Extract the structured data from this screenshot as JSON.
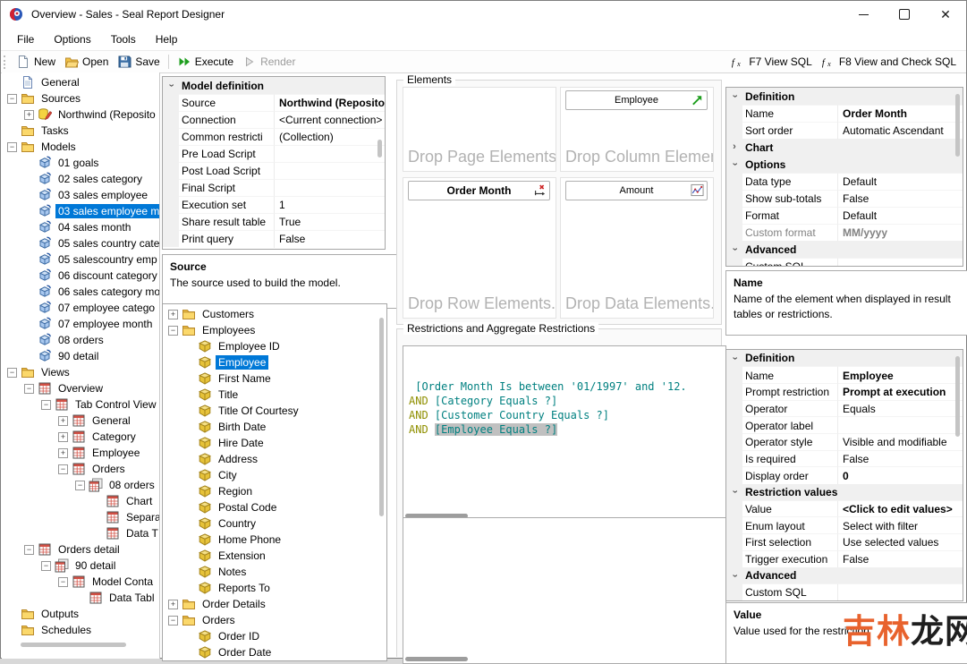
{
  "window": {
    "title": "Overview - Sales - Seal Report Designer"
  },
  "menu": {
    "items": [
      "File",
      "Options",
      "Tools",
      "Help"
    ]
  },
  "toolbar": {
    "buttons": [
      {
        "label": "New",
        "icon": "new-document-icon"
      },
      {
        "label": "Open",
        "icon": "open-folder-icon"
      },
      {
        "label": "Save",
        "icon": "save-icon"
      }
    ],
    "execute": {
      "label": "Execute",
      "icon": "execute-icon"
    },
    "render": {
      "label": "Render",
      "icon": "render-icon"
    },
    "right_buttons": [
      {
        "label": "F7 View SQL",
        "icon": "function-icon"
      },
      {
        "label": "F8 View and Check SQL",
        "icon": "function-icon"
      }
    ]
  },
  "left_tree": {
    "items": [
      {
        "level": 0,
        "exp": "",
        "icon": "document-icon",
        "label": "General"
      },
      {
        "level": 0,
        "exp": "-",
        "icon": "folder-icon",
        "label": "Sources"
      },
      {
        "level": 1,
        "exp": "+",
        "icon": "database-edit-icon",
        "label": "Northwind (Reposito"
      },
      {
        "level": 0,
        "exp": "",
        "icon": "folder-icon",
        "label": "Tasks"
      },
      {
        "level": 0,
        "exp": "-",
        "icon": "folder-icon",
        "label": "Models"
      },
      {
        "level": 1,
        "exp": "",
        "icon": "model-icon",
        "label": "01 goals"
      },
      {
        "level": 1,
        "exp": "",
        "icon": "model-icon",
        "label": "02 sales category"
      },
      {
        "level": 1,
        "exp": "",
        "icon": "model-icon",
        "label": "03 sales employee"
      },
      {
        "level": 1,
        "exp": "",
        "icon": "model-icon",
        "label": "03 sales employee m",
        "selected": true
      },
      {
        "level": 1,
        "exp": "",
        "icon": "model-icon",
        "label": "04 sales month"
      },
      {
        "level": 1,
        "exp": "",
        "icon": "model-icon",
        "label": "05 sales country cate"
      },
      {
        "level": 1,
        "exp": "",
        "icon": "model-icon",
        "label": "05 salescountry emp"
      },
      {
        "level": 1,
        "exp": "",
        "icon": "model-icon",
        "label": "06 discount category"
      },
      {
        "level": 1,
        "exp": "",
        "icon": "model-icon",
        "label": "06 sales category mo"
      },
      {
        "level": 1,
        "exp": "",
        "icon": "model-icon",
        "label": "07 employee catego"
      },
      {
        "level": 1,
        "exp": "",
        "icon": "model-icon",
        "label": "07 employee month"
      },
      {
        "level": 1,
        "exp": "",
        "icon": "model-icon",
        "label": "08 orders"
      },
      {
        "level": 1,
        "exp": "",
        "icon": "model-icon",
        "label": "90 detail"
      },
      {
        "level": 0,
        "exp": "-",
        "icon": "folder-icon",
        "label": "Views"
      },
      {
        "level": 1,
        "exp": "-",
        "icon": "view-icon",
        "label": "Overview"
      },
      {
        "level": 2,
        "exp": "-",
        "icon": "view-icon",
        "label": "Tab Control View"
      },
      {
        "level": 3,
        "exp": "+",
        "icon": "view-icon",
        "label": "General"
      },
      {
        "level": 3,
        "exp": "+",
        "icon": "view-icon",
        "label": "Category"
      },
      {
        "level": 3,
        "exp": "+",
        "icon": "view-icon",
        "label": "Employee"
      },
      {
        "level": 3,
        "exp": "-",
        "icon": "view-icon",
        "label": "Orders"
      },
      {
        "level": 4,
        "exp": "-",
        "icon": "views-stack-icon",
        "label": "08 orders"
      },
      {
        "level": 5,
        "exp": "",
        "icon": "view-icon",
        "label": "Chart"
      },
      {
        "level": 5,
        "exp": "",
        "icon": "view-icon",
        "label": "Separa"
      },
      {
        "level": 5,
        "exp": "",
        "icon": "view-icon",
        "label": "Data T"
      },
      {
        "level": 1,
        "exp": "-",
        "icon": "view-icon",
        "label": "Orders detail"
      },
      {
        "level": 2,
        "exp": "-",
        "icon": "views-stack-icon",
        "label": "90 detail"
      },
      {
        "level": 3,
        "exp": "-",
        "icon": "view-icon",
        "label": "Model Conta"
      },
      {
        "level": 4,
        "exp": "",
        "icon": "view-icon",
        "label": "Data Tabl"
      },
      {
        "level": 0,
        "exp": "",
        "icon": "folder-icon",
        "label": "Outputs"
      },
      {
        "level": 0,
        "exp": "",
        "icon": "folder-icon",
        "label": "Schedules"
      }
    ]
  },
  "model_grid": {
    "rows": [
      {
        "h": "Model definition",
        "chev": "down"
      },
      {
        "l": "Source",
        "v": "Northwind (Reposito",
        "vb": true
      },
      {
        "l": "Connection",
        "v": "<Current connection>"
      },
      {
        "l": "Common restricti",
        "v": "(Collection)"
      },
      {
        "l": "Pre Load Script",
        "v": ""
      },
      {
        "l": "Post Load Script",
        "v": ""
      },
      {
        "l": "Final Script",
        "v": ""
      },
      {
        "l": "Execution set",
        "v": "1"
      },
      {
        "l": "Share result table",
        "v": "True"
      },
      {
        "l": "Print query",
        "v": "False"
      }
    ]
  },
  "source_desc": {
    "title": "Source",
    "text": "The source used to build the model."
  },
  "fields_tree": {
    "items": [
      {
        "level": 0,
        "exp": "+",
        "icon": "folder-icon",
        "label": "Customers"
      },
      {
        "level": 0,
        "exp": "-",
        "icon": "folder-icon",
        "label": "Employees"
      },
      {
        "level": 1,
        "exp": "",
        "icon": "cube-icon",
        "label": "Employee ID"
      },
      {
        "level": 1,
        "exp": "",
        "icon": "cube-icon",
        "label": "Employee",
        "selected": true
      },
      {
        "level": 1,
        "exp": "",
        "icon": "cube-icon",
        "label": "First Name"
      },
      {
        "level": 1,
        "exp": "",
        "icon": "cube-icon",
        "label": "Title"
      },
      {
        "level": 1,
        "exp": "",
        "icon": "cube-icon",
        "label": "Title Of Courtesy"
      },
      {
        "level": 1,
        "exp": "",
        "icon": "cube-icon",
        "label": "Birth Date"
      },
      {
        "level": 1,
        "exp": "",
        "icon": "cube-icon",
        "label": "Hire Date"
      },
      {
        "level": 1,
        "exp": "",
        "icon": "cube-icon",
        "label": "Address"
      },
      {
        "level": 1,
        "exp": "",
        "icon": "cube-icon",
        "label": "City"
      },
      {
        "level": 1,
        "exp": "",
        "icon": "cube-icon",
        "label": "Region"
      },
      {
        "level": 1,
        "exp": "",
        "icon": "cube-icon",
        "label": "Postal Code"
      },
      {
        "level": 1,
        "exp": "",
        "icon": "cube-icon",
        "label": "Country"
      },
      {
        "level": 1,
        "exp": "",
        "icon": "cube-icon",
        "label": "Home Phone"
      },
      {
        "level": 1,
        "exp": "",
        "icon": "cube-icon",
        "label": "Extension"
      },
      {
        "level": 1,
        "exp": "",
        "icon": "cube-icon",
        "label": "Notes"
      },
      {
        "level": 1,
        "exp": "",
        "icon": "cube-icon",
        "label": "Reports To"
      },
      {
        "level": 0,
        "exp": "+",
        "icon": "folder-icon",
        "label": "Order Details"
      },
      {
        "level": 0,
        "exp": "-",
        "icon": "folder-icon",
        "label": "Orders"
      },
      {
        "level": 1,
        "exp": "",
        "icon": "cube-icon",
        "label": "Order ID"
      },
      {
        "level": 1,
        "exp": "",
        "icon": "cube-icon",
        "label": "Order Date"
      }
    ]
  },
  "elements": {
    "group_label": "Elements",
    "zones": [
      {
        "name": "page-elements",
        "placeholder": "Drop Page Elements...",
        "chips": []
      },
      {
        "name": "column-elements",
        "placeholder": "Drop Column Elements",
        "chips": [
          {
            "label": "Employee",
            "icon": "sort-ascending-icon"
          }
        ]
      },
      {
        "name": "row-elements",
        "placeholder": "Drop Row Elements...",
        "chips": [
          {
            "label": "Order Month",
            "icon": "x-axis-remove-icon",
            "bold": true
          }
        ]
      },
      {
        "name": "data-elements",
        "placeholder": "Drop Data Elements...",
        "chips": [
          {
            "label": "Amount",
            "icon": "line-chart-icon"
          }
        ]
      }
    ]
  },
  "restrictions": {
    "group_label": "Restrictions and Aggregate Restrictions",
    "lines": [
      {
        "and": "",
        "text": " [Order Month Is between '01/1997' and '12."
      },
      {
        "and": "AND",
        "text": "[Category Equals ?]"
      },
      {
        "and": "AND",
        "text": "[Customer Country Equals ?]"
      },
      {
        "and": "AND",
        "text": "[Employee Equals ?]",
        "hl": true
      }
    ]
  },
  "element_grid": {
    "rows": [
      {
        "h": "Definition",
        "chev": "down"
      },
      {
        "l": "Name",
        "v": "Order Month",
        "vb": true
      },
      {
        "l": "Sort order",
        "v": "Automatic Ascendant"
      },
      {
        "h": "Chart",
        "chev": "right"
      },
      {
        "h": "Options",
        "chev": "down"
      },
      {
        "l": "Data type",
        "v": "Default"
      },
      {
        "l": "Show sub-totals",
        "v": "False"
      },
      {
        "l": "Format",
        "v": "Default"
      },
      {
        "l": "Custom format",
        "v": "MM/yyyy",
        "lm": true,
        "vm": true,
        "vb": true
      },
      {
        "h": "Advanced",
        "chev": "down"
      },
      {
        "l": "Custom SQL",
        "v": ""
      }
    ]
  },
  "name_desc": {
    "title": "Name",
    "text": "Name of the element when displayed in result tables or restrictions."
  },
  "restriction_grid": {
    "rows": [
      {
        "h": "Definition",
        "chev": "down"
      },
      {
        "l": "Name",
        "v": "Employee",
        "vb": true
      },
      {
        "l": "Prompt restriction",
        "v": "Prompt at execution",
        "vb": true
      },
      {
        "l": "Operator",
        "v": "Equals"
      },
      {
        "l": "Operator label",
        "v": ""
      },
      {
        "l": "Operator style",
        "v": "Visible and modifiable"
      },
      {
        "l": "Is required",
        "v": "False"
      },
      {
        "l": "Display order",
        "v": "0",
        "vb": true
      },
      {
        "h": "Restriction values",
        "chev": "down"
      },
      {
        "l": "Value",
        "v": "<Click to edit values>",
        "vb": true
      },
      {
        "l": "Enum layout",
        "v": "Select with filter"
      },
      {
        "l": "First selection",
        "v": "Use selected values"
      },
      {
        "l": "Trigger execution",
        "v": "False"
      },
      {
        "h": "Advanced",
        "chev": "down"
      },
      {
        "l": "Custom SQL",
        "v": ""
      }
    ]
  },
  "value_desc": {
    "title": "Value",
    "text": "Value used for the restriction"
  },
  "watermark": {
    "part1": "吉林",
    "part2": "龙网"
  },
  "colors": {
    "selection": "#0078d7",
    "restriction_text": "#008080",
    "keyword": "#8f8f00",
    "highlight": "#c0c0c0",
    "execute_green": "#1e9e1e",
    "watermark_orange": "#e8622d"
  }
}
